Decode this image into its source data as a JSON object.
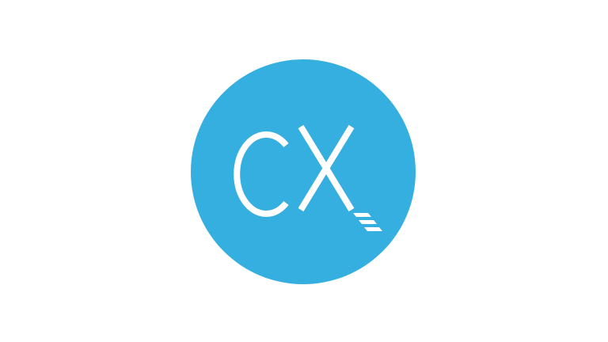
{
  "logo": {
    "text": "CX",
    "colors": {
      "circle": "#35AFE0",
      "glyph": "#FFFFFF",
      "background": "#FFFFFF"
    }
  }
}
